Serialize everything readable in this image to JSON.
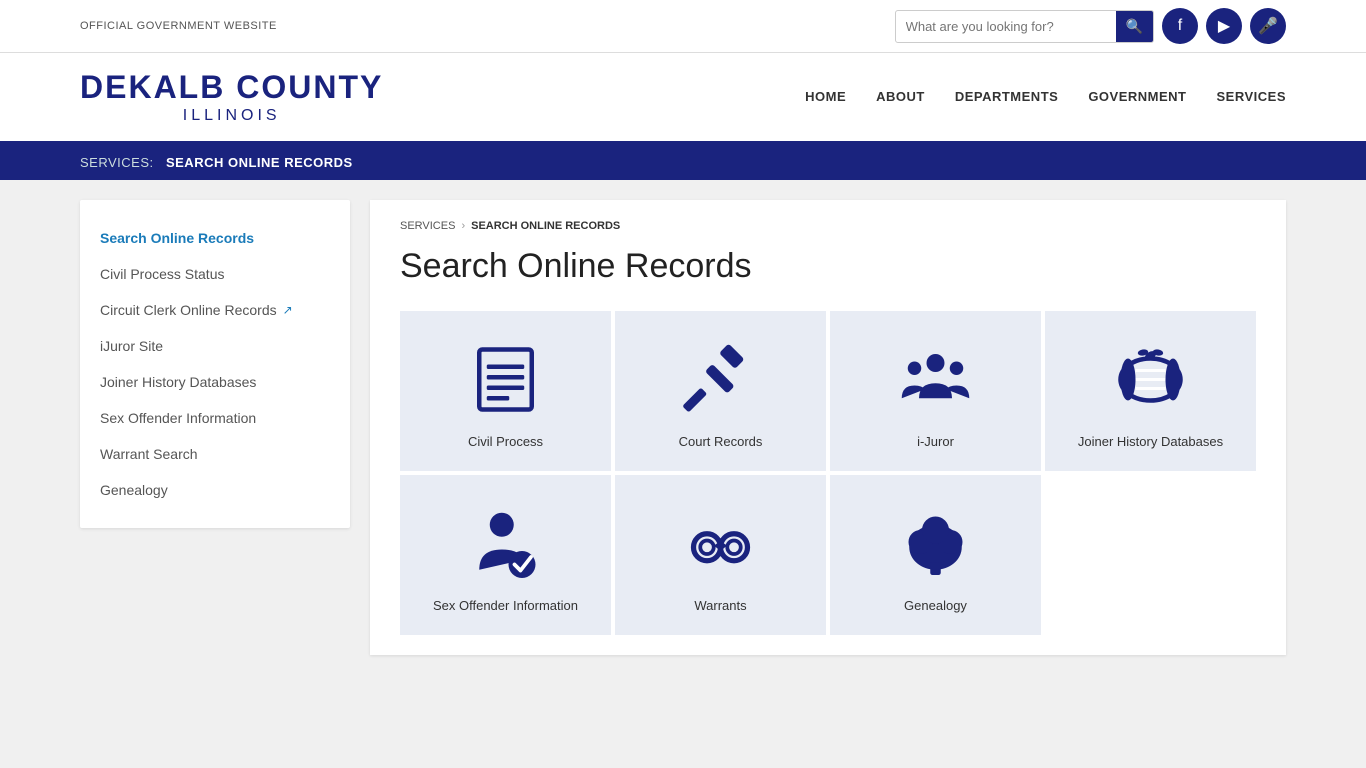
{
  "topbar": {
    "official_text": "OFFICIAL GOVERNMENT WEBSITE",
    "search_placeholder": "What are you looking for?"
  },
  "header": {
    "logo_county": "DEKALB COUNTY",
    "logo_state": "ILLINOIS",
    "nav": [
      "HOME",
      "ABOUT",
      "DEPARTMENTS",
      "GOVERNMENT",
      "SERVICES"
    ]
  },
  "breadcrumb_banner": {
    "label": "SERVICES:",
    "current": "SEARCH ONLINE RECORDS"
  },
  "sidebar": {
    "active_item": "Search Online Records",
    "items": [
      {
        "label": "Search Online Records",
        "active": true,
        "external": false
      },
      {
        "label": "Civil Process Status",
        "active": false,
        "external": false
      },
      {
        "label": "Circuit Clerk Online Records",
        "active": false,
        "external": true
      },
      {
        "label": "iJuror Site",
        "active": false,
        "external": false
      },
      {
        "label": "Joiner History Databases",
        "active": false,
        "external": false
      },
      {
        "label": "Sex Offender Information",
        "active": false,
        "external": false
      },
      {
        "label": "Warrant Search",
        "active": false,
        "external": false
      },
      {
        "label": "Genealogy",
        "active": false,
        "external": false
      }
    ]
  },
  "breadcrumb": {
    "services": "SERVICES",
    "current": "SEARCH ONLINE RECORDS"
  },
  "page_title": "Search Online Records",
  "cards": [
    {
      "label": "Civil Process",
      "icon": "civil"
    },
    {
      "label": "Court Records",
      "icon": "court"
    },
    {
      "label": "i-Juror",
      "icon": "juror"
    },
    {
      "label": "Joiner History Databases",
      "icon": "joiner"
    },
    {
      "label": "Sex Offender Information",
      "icon": "sex-offender"
    },
    {
      "label": "Warrants",
      "icon": "warrants"
    },
    {
      "label": "Genealogy",
      "icon": "genealogy"
    }
  ]
}
